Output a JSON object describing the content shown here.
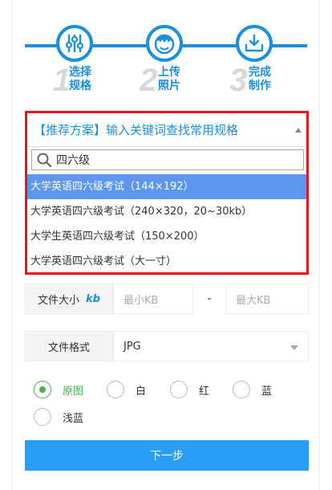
{
  "steps": [
    {
      "num": "1",
      "line1": "选择",
      "line2": "规格",
      "icon": "sliders-icon"
    },
    {
      "num": "2",
      "line1": "上传",
      "line2": "照片",
      "icon": "face-icon"
    },
    {
      "num": "3",
      "line1": "完成",
      "line2": "制作",
      "icon": "download-icon"
    }
  ],
  "dropdown": {
    "selected": "【推荐方案】输入关键词查找常用规格",
    "search_value": "四六级",
    "options": [
      "大学英语四六级考试（144×192）",
      "大学英语四六级考试（240×320，20~30kb）",
      "大学生英语四六级考试（150×200）",
      "大学英语四六级考试（大一寸）"
    ]
  },
  "filesize": {
    "label": "文件大小",
    "unit": "kb",
    "min_placeholder": "最小KB",
    "separator": "-",
    "max_placeholder": "最大KB"
  },
  "format": {
    "label": "文件格式",
    "value": "JPG"
  },
  "background": {
    "options": [
      "原图",
      "白",
      "红",
      "蓝",
      "浅蓝"
    ],
    "selected": "原图"
  },
  "next_button": "下一步",
  "colors": {
    "accent": "#1a8fdc",
    "highlight": "#e8131c",
    "checked": "#4bb04b",
    "button": "#2a9df4"
  }
}
